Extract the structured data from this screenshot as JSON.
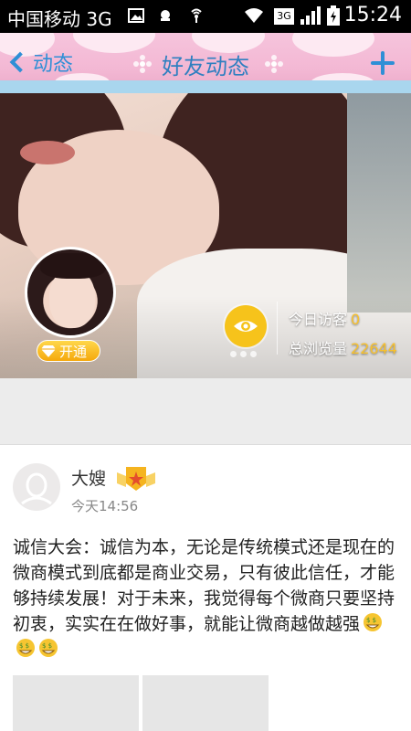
{
  "status_bar": {
    "carrier": "中国移动 3G",
    "network": "3G",
    "time": "15:24"
  },
  "header": {
    "back_label": "动态",
    "title": "好友动态"
  },
  "profile": {
    "vip_label": "开通",
    "today_visitors_label": "今日访客",
    "today_visitors_value": "0",
    "total_views_label": "总浏览量",
    "total_views_value": "22644"
  },
  "post": {
    "author": "大嫂",
    "time": "今天14:56",
    "text": "诚信大会：诚信为本，无论是传统模式还是现在的微商模式到底都是商业交易，只有彼此信任，才能够持续发展！对于未来，我觉得每个微商只要坚持初衷，实实在在做好事，就能让微商越做越强",
    "emoji_count": 3
  },
  "colors": {
    "accent": "#2f8fd6",
    "gold": "#f8c12c",
    "header_pink": "#f3b8d4"
  },
  "icons": [
    "back-chevron-icon",
    "add-icon",
    "eye-icon",
    "diamond-icon",
    "rank-badge-icon",
    "default-avatar-icon",
    "money-grin-emoji"
  ]
}
